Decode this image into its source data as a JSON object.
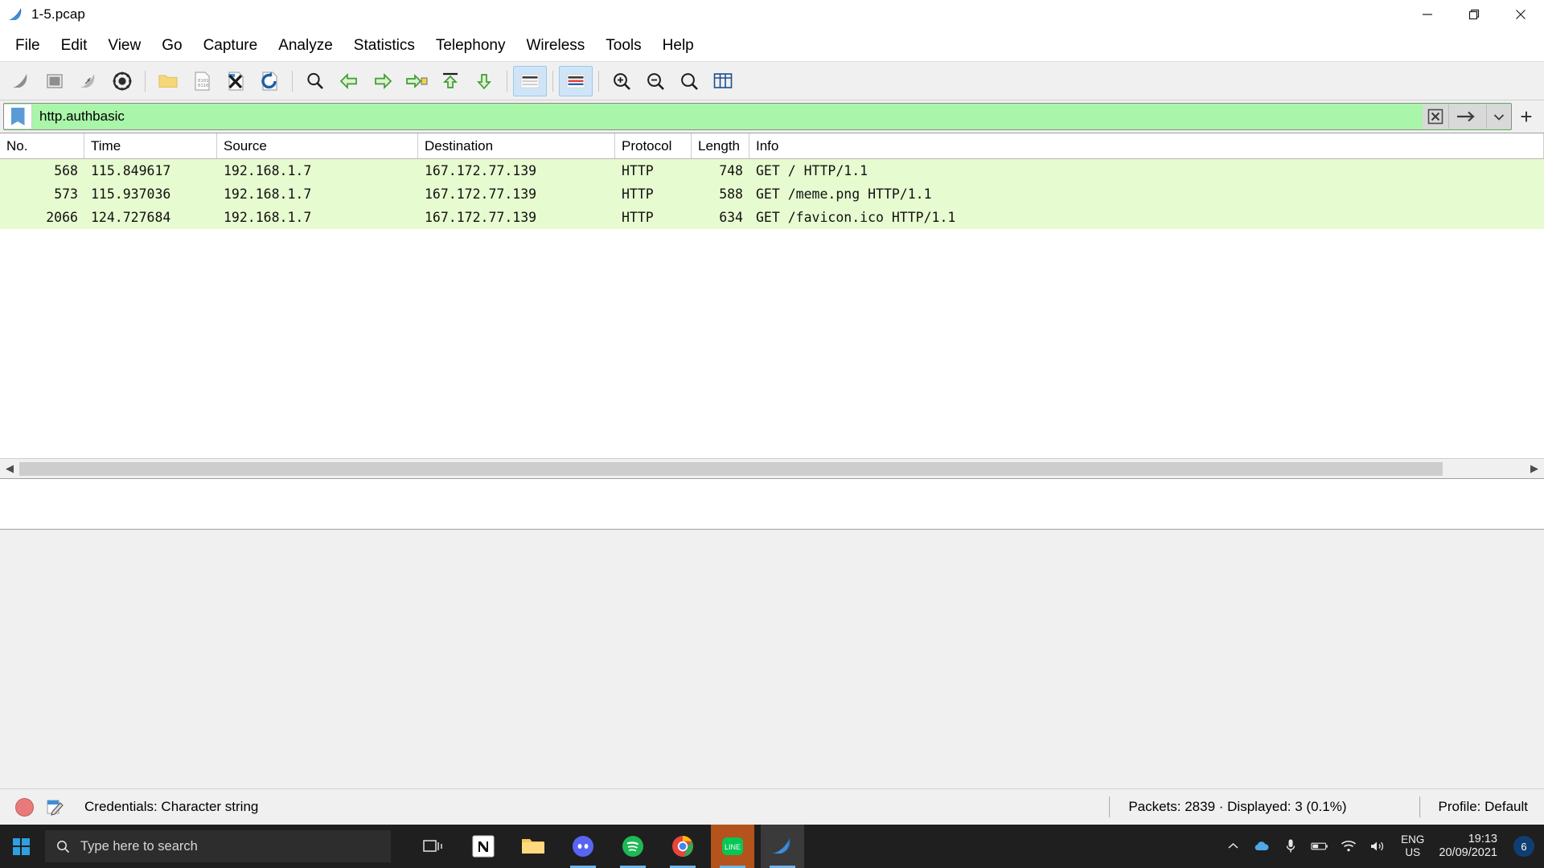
{
  "window": {
    "title": "1-5.pcap",
    "app_icon": "wireshark-shark-fin-icon",
    "minimize": "minimize-icon",
    "maximize": "restore-icon",
    "close": "close-icon"
  },
  "menubar": {
    "items": [
      {
        "label": "File"
      },
      {
        "label": "Edit"
      },
      {
        "label": "View"
      },
      {
        "label": "Go"
      },
      {
        "label": "Capture"
      },
      {
        "label": "Analyze"
      },
      {
        "label": "Statistics"
      },
      {
        "label": "Telephony"
      },
      {
        "label": "Wireless"
      },
      {
        "label": "Tools"
      },
      {
        "label": "Help"
      }
    ]
  },
  "toolbar": {
    "buttons": [
      {
        "name": "start-capture-icon",
        "active": false
      },
      {
        "name": "stop-capture-icon",
        "active": false
      },
      {
        "name": "restart-capture-icon",
        "active": false
      },
      {
        "name": "capture-options-icon",
        "active": false
      },
      {
        "name": "open-file-icon",
        "active": false
      },
      {
        "name": "save-file-icon",
        "active": false
      },
      {
        "name": "close-file-icon",
        "active": false
      },
      {
        "name": "reload-file-icon",
        "active": false
      },
      {
        "name": "find-packet-icon",
        "active": false
      },
      {
        "name": "go-back-icon",
        "active": false
      },
      {
        "name": "go-forward-icon",
        "active": false
      },
      {
        "name": "go-to-packet-icon",
        "active": false
      },
      {
        "name": "go-to-first-packet-icon",
        "active": false
      },
      {
        "name": "go-to-last-packet-icon",
        "active": false
      },
      {
        "name": "auto-scroll-icon",
        "active": true
      },
      {
        "name": "colorize-packets-icon",
        "active": true
      },
      {
        "name": "zoom-in-icon",
        "active": false
      },
      {
        "name": "zoom-out-icon",
        "active": false
      },
      {
        "name": "zoom-reset-icon",
        "active": false
      },
      {
        "name": "resize-columns-icon",
        "active": false
      }
    ]
  },
  "filter": {
    "bookmark_icon": "bookmark-icon",
    "value": "http.authbasic",
    "placeholder": "Apply a display filter ... <Ctrl-/>",
    "valid": true,
    "clear_icon": "clear-filter-icon",
    "apply_icon": "apply-filter-arrow-icon",
    "dropdown_icon": "filter-history-chevron-down-icon",
    "add_icon": "add-filter-button-icon",
    "background_color": "#a9f5a9"
  },
  "packet_list": {
    "columns": [
      {
        "key": "no",
        "label": "No."
      },
      {
        "key": "time",
        "label": "Time"
      },
      {
        "key": "source",
        "label": "Source"
      },
      {
        "key": "destination",
        "label": "Destination"
      },
      {
        "key": "protocol",
        "label": "Protocol"
      },
      {
        "key": "length",
        "label": "Length"
      },
      {
        "key": "info",
        "label": "Info"
      }
    ],
    "row_color": "#e7fbd0",
    "rows": [
      {
        "no": "568",
        "time": "115.849617",
        "source": "192.168.1.7",
        "destination": "167.172.77.139",
        "protocol": "HTTP",
        "length": "748",
        "info": "GET / HTTP/1.1"
      },
      {
        "no": "573",
        "time": "115.937036",
        "source": "192.168.1.7",
        "destination": "167.172.77.139",
        "protocol": "HTTP",
        "length": "588",
        "info": "GET /meme.png HTTP/1.1"
      },
      {
        "no": "2066",
        "time": "124.727684",
        "source": "192.168.1.7",
        "destination": "167.172.77.139",
        "protocol": "HTTP",
        "length": "634",
        "info": "GET /favicon.ico HTTP/1.1"
      }
    ]
  },
  "scrollbar": {
    "left_arrow": "scroll-left-icon",
    "right_arrow": "scroll-right-icon"
  },
  "statusbar": {
    "expert_icon": "expert-info-icon",
    "annotation_icon": "capture-file-comment-icon",
    "field_text": "Credentials: Character string",
    "packets_text": "Packets: 2839 · Displayed: 3 (0.1%)",
    "profile_text": "Profile: Default"
  },
  "taskbar": {
    "start_icon": "windows-start-icon",
    "search_icon": "search-icon",
    "search_placeholder": "Type here to search",
    "apps": [
      {
        "name": "task-view-icon"
      },
      {
        "name": "notion-icon"
      },
      {
        "name": "file-explorer-icon"
      },
      {
        "name": "discord-icon"
      },
      {
        "name": "spotify-icon"
      },
      {
        "name": "chrome-icon"
      },
      {
        "name": "line-icon"
      },
      {
        "name": "wireshark-icon"
      }
    ],
    "tray": {
      "chevron_icon": "show-hidden-icons-chevron-up-icon",
      "onedrive_icon": "onedrive-cloud-icon",
      "mic_icon": "microphone-icon",
      "battery_icon": "battery-icon",
      "wifi_icon": "wifi-icon",
      "volume_icon": "volume-icon",
      "lang_line1": "ENG",
      "lang_line2": "US",
      "clock_time": "19:13",
      "clock_date": "20/09/2021",
      "notification_count": "6",
      "notification_icon": "notifications-icon"
    }
  }
}
